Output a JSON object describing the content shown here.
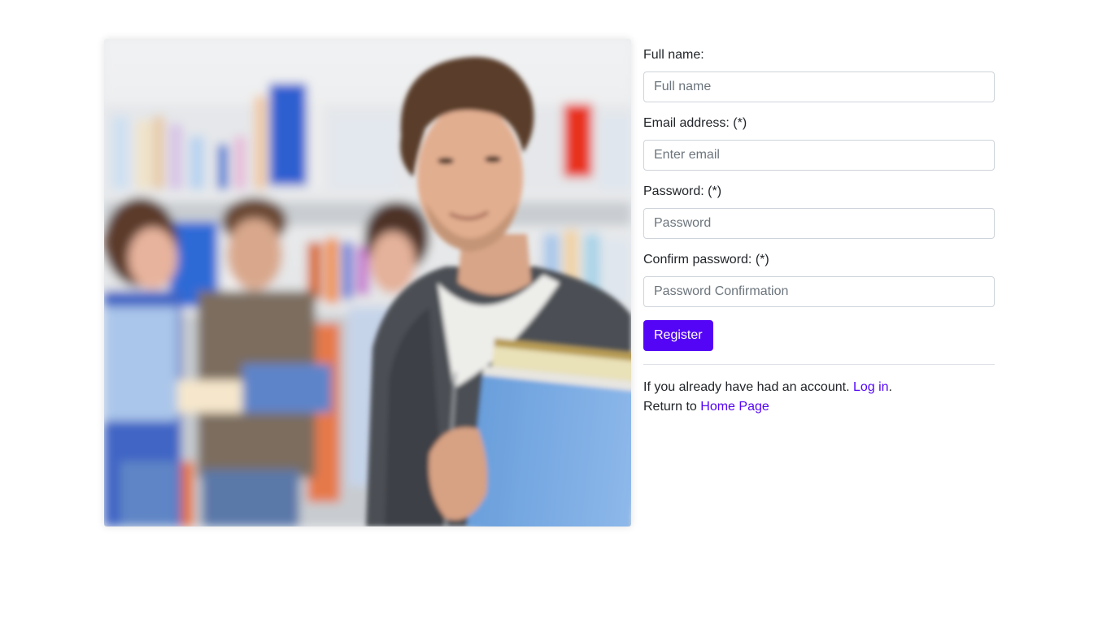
{
  "hero": {
    "image_alt": "Student holding books in a library"
  },
  "form": {
    "fullname": {
      "label": "Full name:",
      "placeholder": "Full name"
    },
    "email": {
      "label": "Email address: (*)",
      "placeholder": "Enter email"
    },
    "password": {
      "label": "Password: (*)",
      "placeholder": "Password"
    },
    "confirm": {
      "label": "Confirm password: (*)",
      "placeholder": "Password Confirmation"
    },
    "submit_label": "Register"
  },
  "footer": {
    "account_text": "If you already have had an account. ",
    "login_link": "Log in",
    "account_suffix": ".",
    "return_text": "Return to ",
    "home_link": "Home Page"
  },
  "colors": {
    "primary": "#5405f6",
    "input_border": "#ced4da",
    "text": "#212529"
  }
}
